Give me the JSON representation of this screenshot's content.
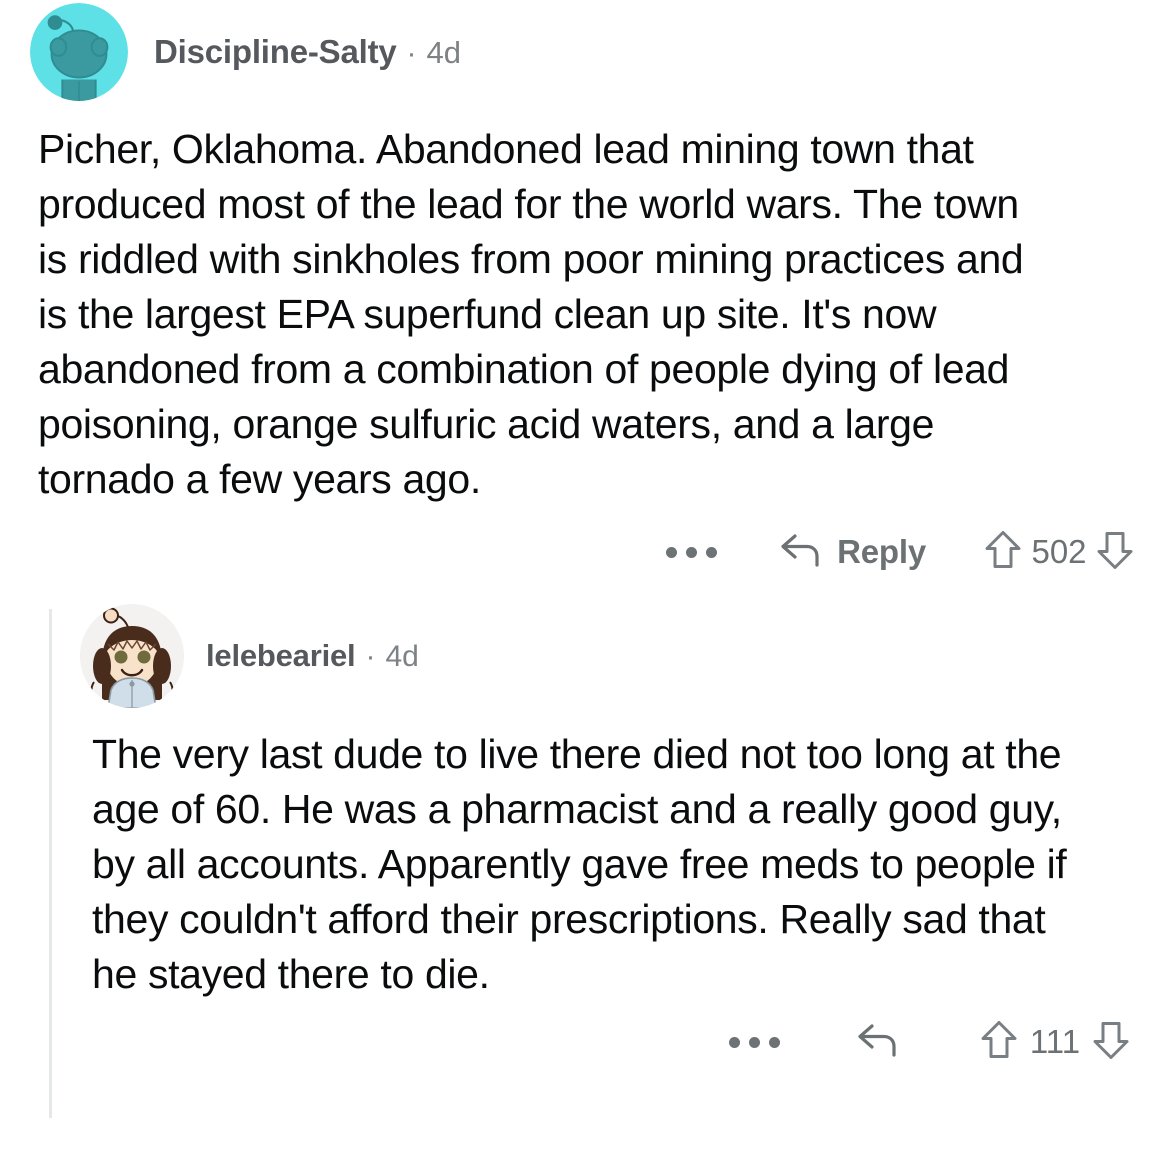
{
  "app": {
    "platform": "reddit-comment-thread",
    "background_color": "#ffffff",
    "text_color": "#0b0c0d",
    "meta_color": "#7d8285",
    "thread_line_color": "#e6e7e8"
  },
  "comments": [
    {
      "id": "root-comment",
      "author": "Discipline-Salty",
      "separator": "·",
      "timestamp": "4d",
      "avatar": {
        "name": "reddit-snoo-avatar",
        "background_color": "#5ee1e6",
        "body_color": "#2f8d92"
      },
      "body": "Picher, Oklahoma. Abandoned lead mining town that produced most of the lead for the world wars. The town is riddled with sinkholes from poor mining practices and is the largest EPA superfund clean up site. It's now abandoned from a combination of people dying of lead poisoning, orange sulfuric acid waters, and a large tornado a few years ago.",
      "actions": {
        "more_label": "…",
        "more_icon": "ellipsis-icon",
        "reply_icon": "reply-arrow-icon",
        "reply_label": "Reply",
        "upvote_icon": "upvote-arrow-icon",
        "downvote_icon": "downvote-arrow-icon",
        "vote_count": "502"
      }
    },
    {
      "id": "reply-comment",
      "author": "lelebeariel",
      "separator": "·",
      "timestamp": "4d",
      "avatar": {
        "name": "custom-girl-avatar",
        "background_color": "#f3f2f0",
        "hair_color": "#4a2c1d",
        "skin_color": "#f6dcc3",
        "shirt_color": "#cfdee8"
      },
      "body": "The very last dude to live there died not too long at the age of 60. He was a pharmacist and a really good guy, by all accounts. Apparently gave free meds to people if they couldn't afford their prescriptions. Really sad that he stayed there to die.",
      "actions": {
        "more_label": "…",
        "more_icon": "ellipsis-icon",
        "reply_icon": "reply-arrow-icon",
        "reply_label": "",
        "upvote_icon": "upvote-arrow-icon",
        "downvote_icon": "downvote-arrow-icon",
        "vote_count": "111"
      }
    }
  ]
}
